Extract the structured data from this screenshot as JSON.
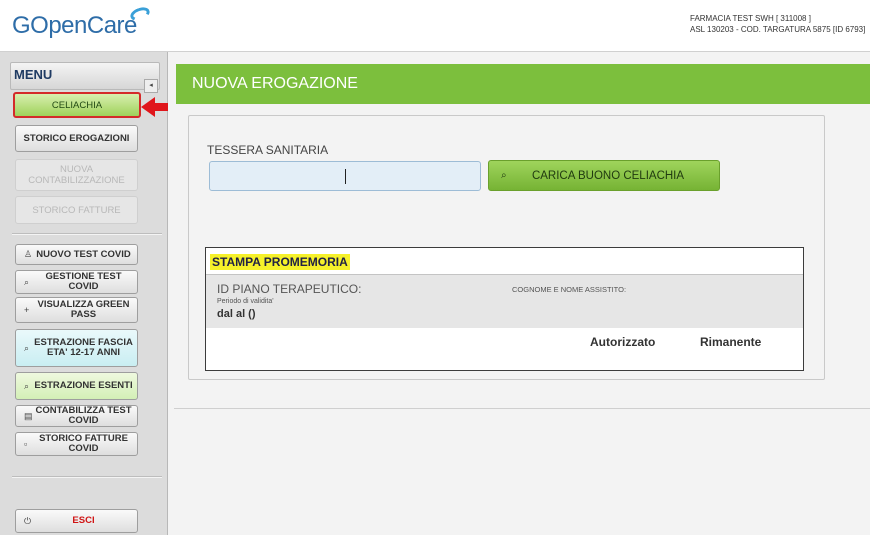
{
  "header": {
    "logo_text": "GOpenCare",
    "pharmacy_line1": "FARMACIA TEST SWH [ 311008 ]",
    "pharmacy_line2": "ASL 130203 - COD. TARGATURA 5875 [ID 6793]"
  },
  "sidebar": {
    "menu_title": "MENU",
    "collapse_icon": "◂",
    "items": [
      {
        "label": "CELIACHIA",
        "icon": ""
      },
      {
        "label": "STORICO EROGAZIONI",
        "icon": ""
      },
      {
        "label": "NUOVA CONTABILIZZAZIONE",
        "icon": ""
      },
      {
        "label": "STORICO FATTURE",
        "icon": ""
      },
      {
        "label": "NUOVO TEST COVID",
        "icon": "user-icon"
      },
      {
        "label": "GESTIONE TEST COVID",
        "icon": "search-icon"
      },
      {
        "label": "VISUALIZZA GREEN PASS",
        "icon": "plus-icon"
      },
      {
        "label": "ESTRAZIONE FASCIA ETA' 12-17 ANNI",
        "icon": "search-icon"
      },
      {
        "label": "ESTRAZIONE ESENTI",
        "icon": "search-icon"
      },
      {
        "label": "CONTABILIZZA TEST COVID",
        "icon": "document-icon"
      },
      {
        "label": "STORICO FATTURE COVID",
        "icon": "document-icon"
      },
      {
        "label": "ESCI",
        "icon": "power-icon"
      }
    ]
  },
  "main": {
    "title": "NUOVA EROGAZIONE",
    "card_label": "TESSERA SANITARIA",
    "card_value": "",
    "load_button": "CARICA BUONO CELIACHIA",
    "reminder": {
      "title": "STAMPA PROMEMORIA",
      "plan_id_label": "ID PIANO TERAPEUTICO:",
      "validity_label": "Periodo di validita'",
      "validity_value": "dal al ()",
      "patient_label": "COGNOME E NOME ASSISTITO:",
      "authorized_label": "Autorizzato",
      "remaining_label": "Rimanente"
    }
  },
  "colors": {
    "accent_green": "#7cbf3d",
    "highlight_red": "#d42a2a",
    "highlight_yellow": "#f6f12a"
  }
}
